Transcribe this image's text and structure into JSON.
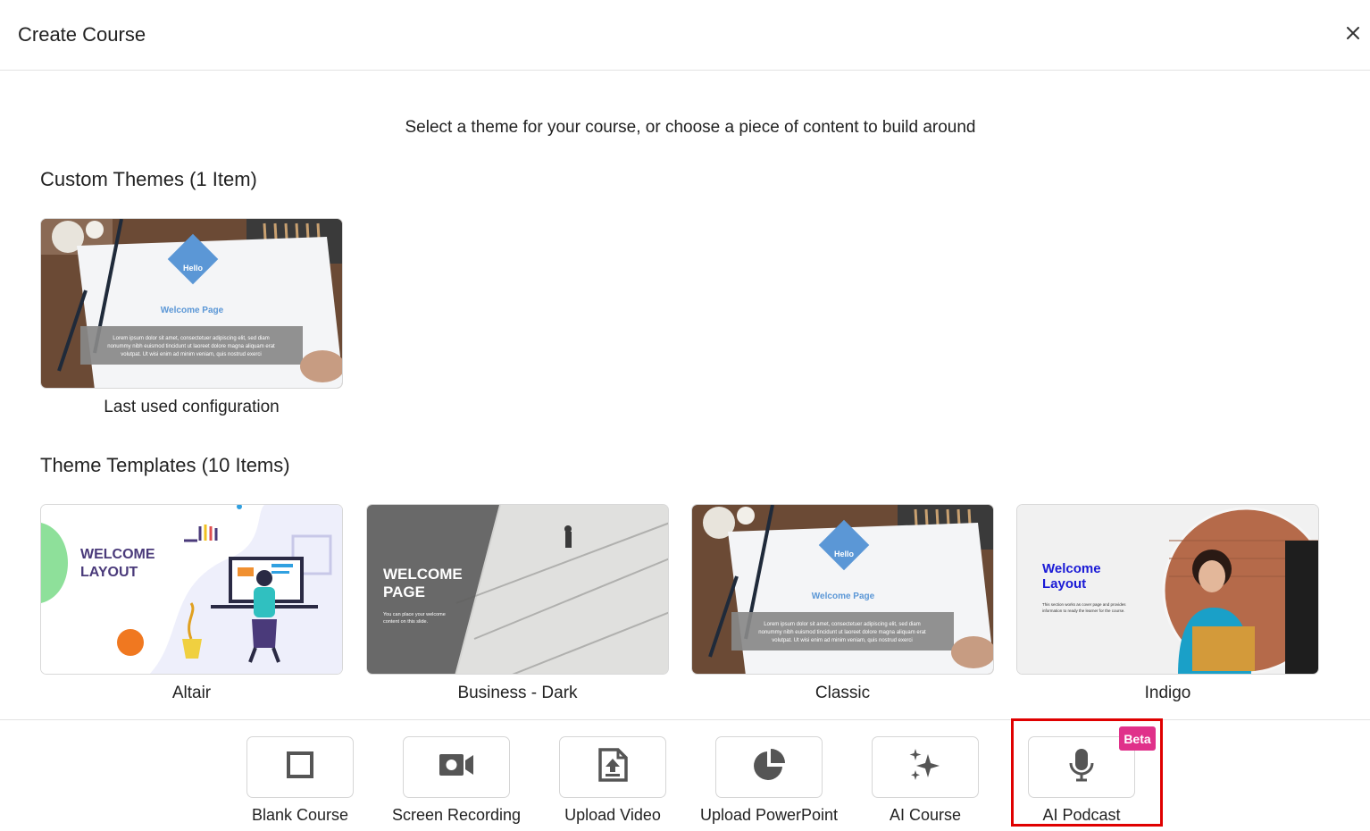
{
  "header": {
    "title": "Create Course",
    "close_icon": "close-icon"
  },
  "subtitle": "Select a theme for your course, or choose a piece of content to build around",
  "custom_themes": {
    "heading": "Custom Themes (1 Item)",
    "items": [
      {
        "label": "Last used configuration",
        "thumb_hello": "Hello",
        "thumb_title": "Welcome Page",
        "thumb_body": [
          "Lorem ipsum dolor sit amet, consectetuer adipiscing elit, sed diam",
          "nonummy nibh euismod tincidunt ut laoreet dolore magna aliquam erat",
          "volutpat. Ut wisi enim ad minim veniam, quis nostrud exerci"
        ]
      }
    ]
  },
  "theme_templates": {
    "heading": "Theme Templates (10 Items)",
    "items": [
      {
        "label": "Altair",
        "thumb_title": [
          "WELCOME",
          "LAYOUT"
        ]
      },
      {
        "label": "Business - Dark",
        "thumb_title": [
          "WELCOME",
          "PAGE"
        ],
        "thumb_body": [
          "You can place your welcome",
          "content on this slide."
        ]
      },
      {
        "label": "Classic",
        "thumb_hello": "Hello",
        "thumb_title": "Welcome Page",
        "thumb_body": [
          "Lorem ipsum dolor sit amet, consectetuer adipiscing elit, sed diam",
          "nonummy nibh euismod tincidunt ut laoreet dolore magna aliquam erat",
          "volutpat. Ut wisi enim ad minim veniam, quis nostrud exerci"
        ]
      },
      {
        "label": "Indigo",
        "thumb_title": [
          "Welcome",
          "Layout"
        ],
        "thumb_body": [
          "This section works as cover page and provides",
          "information to ready the learner for the course."
        ]
      }
    ]
  },
  "actions": [
    {
      "label": "Blank Course",
      "icon": "square-outline-icon"
    },
    {
      "label": "Screen Recording",
      "icon": "video-camera-icon"
    },
    {
      "label": "Upload Video",
      "icon": "file-upload-icon"
    },
    {
      "label": "Upload PowerPoint",
      "icon": "pie-chart-icon"
    },
    {
      "label": "AI Course",
      "icon": "sparkles-icon"
    },
    {
      "label": "AI Podcast",
      "icon": "microphone-icon",
      "badge": "Beta"
    }
  ],
  "colors": {
    "accent_badge": "#e0318a",
    "highlight": "#e00000",
    "classic_blue": "#5b97d6",
    "indigo_blue": "#1a1ad6",
    "altair_purple": "#4a3a7a"
  }
}
